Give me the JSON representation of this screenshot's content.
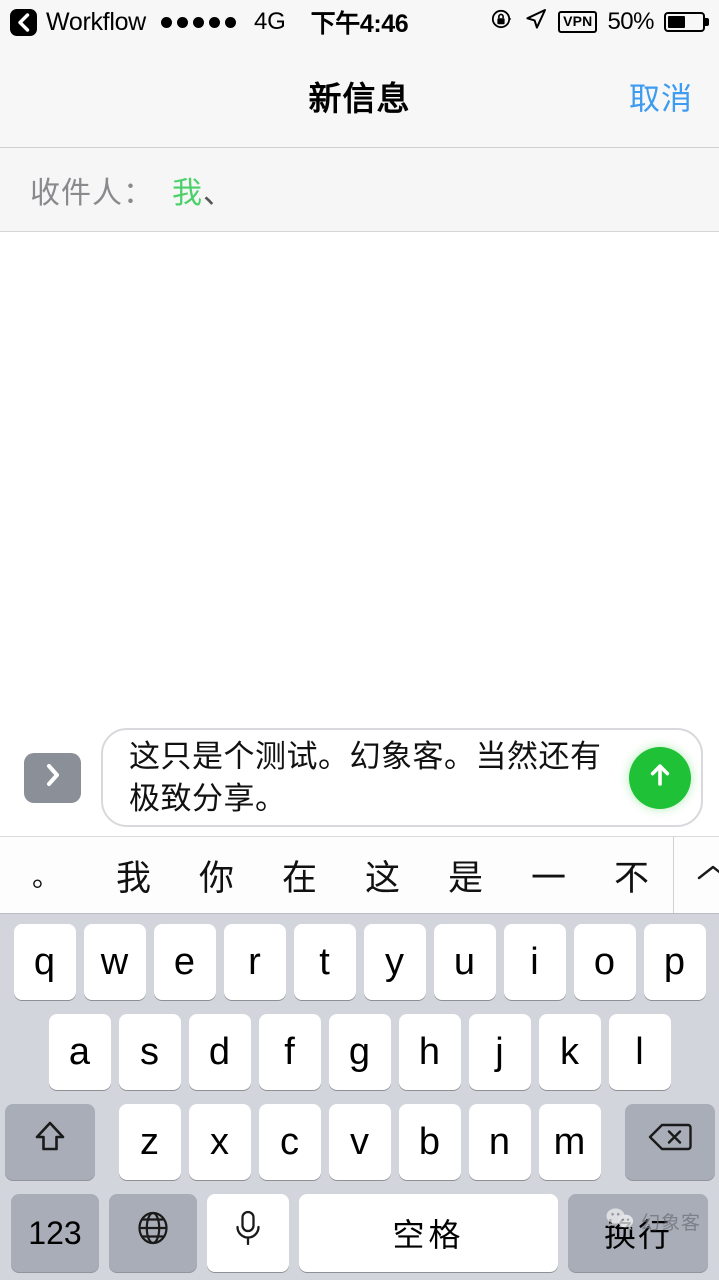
{
  "status_bar": {
    "back_label": "Workflow",
    "back_icon": "chevron-left-icon",
    "signal_dots": 5,
    "network": "4G",
    "time": "下午4:46",
    "rotation_lock_icon": "rotation-lock-icon",
    "location_icon": "location-arrow-icon",
    "vpn": "VPN",
    "battery_percent": "50%",
    "battery_level": 50
  },
  "nav_bar": {
    "title": "新信息",
    "cancel_label": "取消"
  },
  "recipient": {
    "label": "收件人：",
    "token": "我",
    "separator": "、"
  },
  "input_bar": {
    "expand_icon": "chevron-right-icon",
    "message_text": "这只是个测试。幻象客。当然还有极致分享。",
    "send_icon": "arrow-up-icon"
  },
  "suggestions": {
    "items": [
      "。",
      "我",
      "你",
      "在",
      "这",
      "是",
      "一",
      "不"
    ],
    "expand_icon": "chevron-up-icon"
  },
  "keyboard": {
    "row1": [
      "q",
      "w",
      "e",
      "r",
      "t",
      "y",
      "u",
      "i",
      "o",
      "p"
    ],
    "row2": [
      "a",
      "s",
      "d",
      "f",
      "g",
      "h",
      "j",
      "k",
      "l"
    ],
    "row3": [
      "z",
      "x",
      "c",
      "v",
      "b",
      "n",
      "m"
    ],
    "shift_icon": "shift-arrow-icon",
    "backspace_icon": "backspace-icon",
    "numbers_label": "123",
    "globe_icon": "globe-icon",
    "mic_icon": "microphone-icon",
    "space_label": "空格",
    "return_label": "换行"
  },
  "watermark": {
    "icon": "wechat-icon",
    "text": "幻象客"
  },
  "colors": {
    "accent_blue": "#3d9bf0",
    "send_green": "#1fc236",
    "recipient_green": "#4cd06a",
    "keyboard_bg": "#d2d5db",
    "special_key": "#a8adb7"
  }
}
